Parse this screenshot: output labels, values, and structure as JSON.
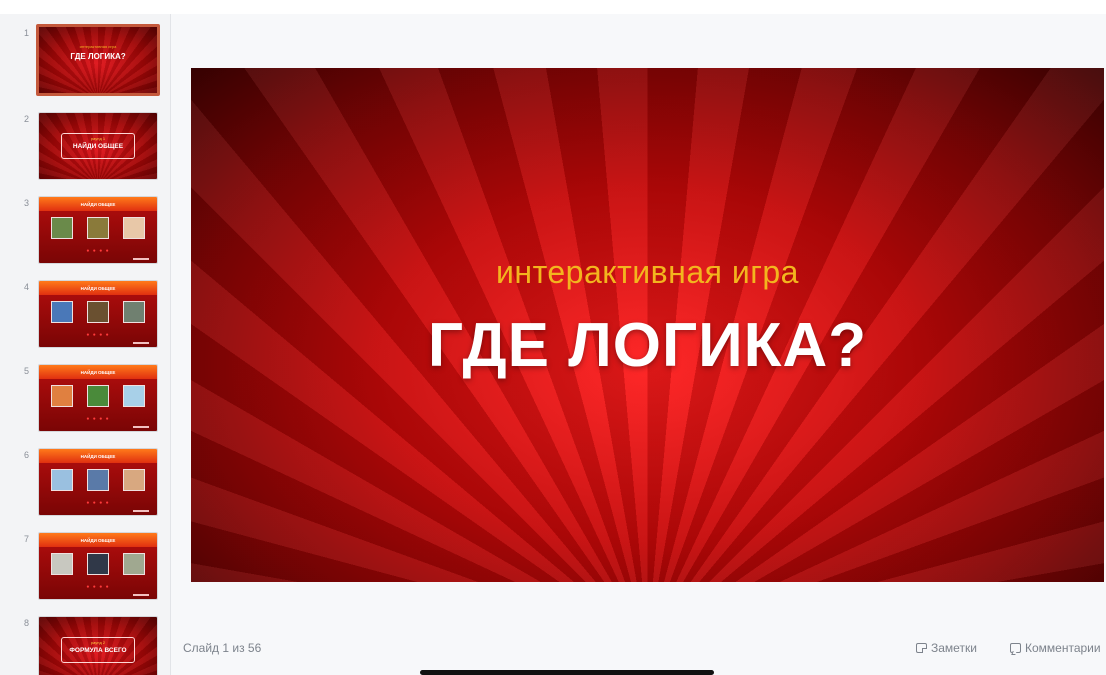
{
  "sidebar": {
    "slides": [
      {
        "num": "1",
        "kind": "title",
        "sub": "интерактивная игра",
        "title": "ГДЕ ЛОГИКА?",
        "active": true
      },
      {
        "num": "2",
        "kind": "frame",
        "sub": "раунд 1",
        "title": "НАЙДИ ОБЩЕЕ"
      },
      {
        "num": "3",
        "kind": "question",
        "title": "НАЙДИ ОБЩЕЕ",
        "colors": [
          "#6a8a4a",
          "#8a7a3a",
          "#e8c8a8"
        ]
      },
      {
        "num": "4",
        "kind": "question",
        "title": "НАЙДИ ОБЩЕЕ",
        "colors": [
          "#4a78b8",
          "#6a5030",
          "#708070"
        ]
      },
      {
        "num": "5",
        "kind": "question",
        "title": "НАЙДИ ОБЩЕЕ",
        "colors": [
          "#e08040",
          "#4a8a3a",
          "#a8d0e8"
        ]
      },
      {
        "num": "6",
        "kind": "question",
        "title": "НАЙДИ ОБЩЕЕ",
        "colors": [
          "#9ac0e0",
          "#5a7aa8",
          "#d8a880"
        ]
      },
      {
        "num": "7",
        "kind": "question",
        "title": "НАЙДИ ОБЩЕЕ",
        "colors": [
          "#c8c8c0",
          "#303848",
          "#a0a890"
        ]
      },
      {
        "num": "8",
        "kind": "frame",
        "sub": "раунд 2",
        "title": "ФОРМУЛА ВСЕГО"
      }
    ]
  },
  "slide": {
    "subtitle": "интерактивная игра",
    "title": "ГДЕ ЛОГИКА?"
  },
  "status": {
    "counter": "Слайд 1 из 56",
    "notes": "Заметки",
    "comments": "Комментарии"
  }
}
